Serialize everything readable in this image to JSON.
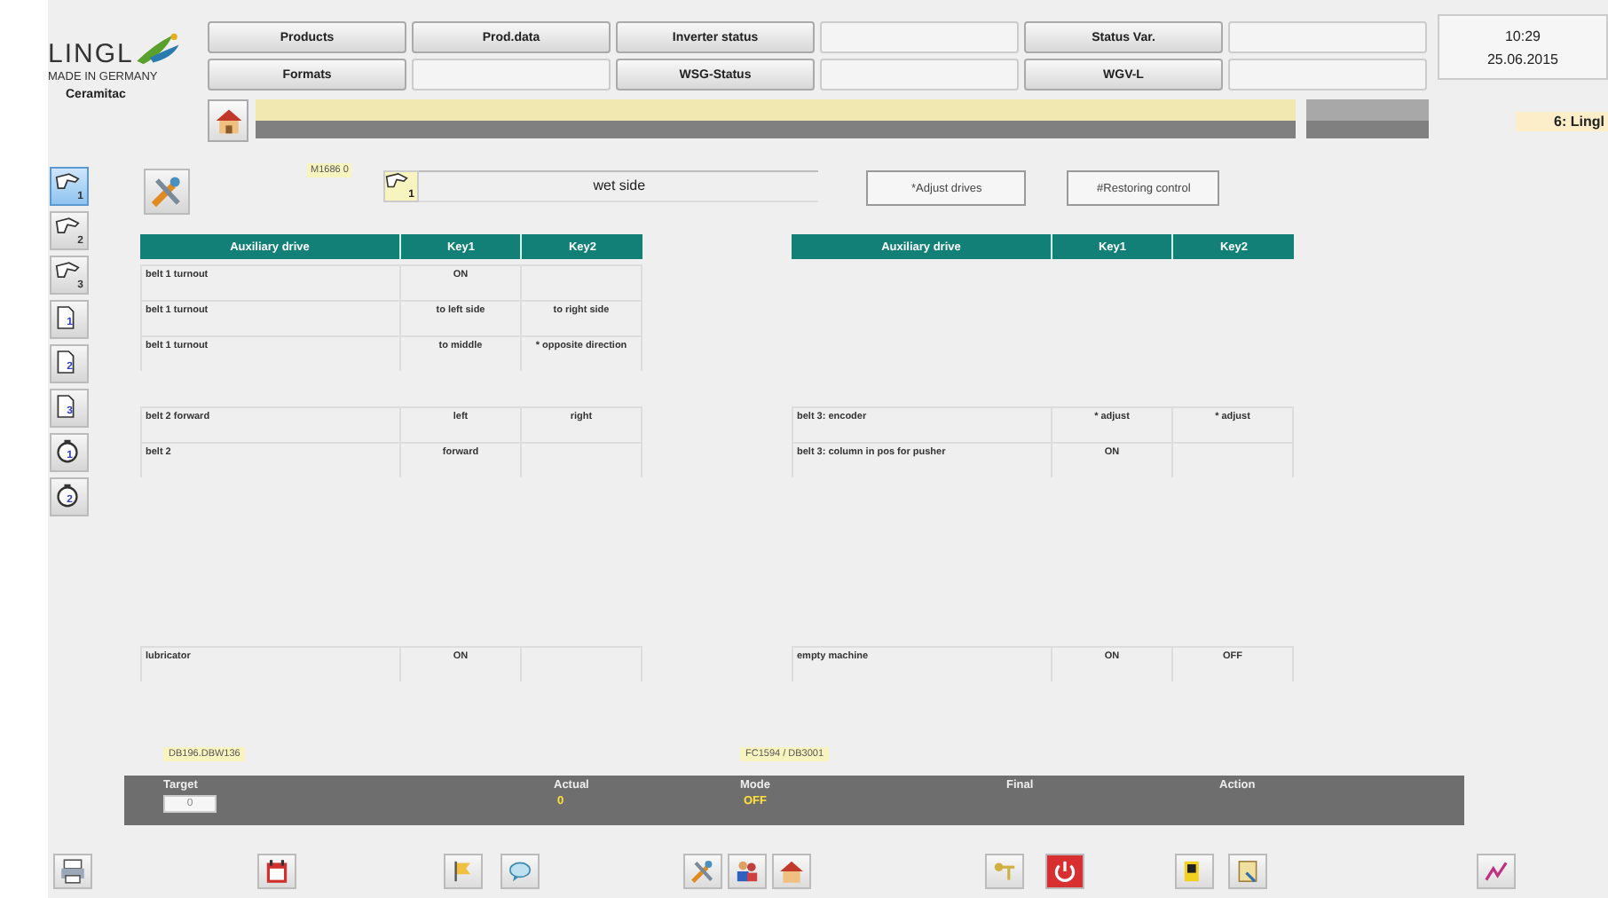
{
  "header": {
    "brand": "LINGL",
    "tagline": "MADE IN GERMANY",
    "site": "Ceramitac",
    "nav": [
      {
        "kind": "button",
        "label": "Products"
      },
      {
        "kind": "button",
        "label": "Prod.data"
      },
      {
        "kind": "button",
        "label": "Inverter status"
      },
      {
        "kind": "blank"
      },
      {
        "kind": "button",
        "label": "Status Var."
      },
      {
        "kind": "blank"
      },
      {
        "kind": "button",
        "label": "Formats"
      },
      {
        "kind": "blank"
      },
      {
        "kind": "button",
        "label": "WSG-Status"
      },
      {
        "kind": "blank"
      },
      {
        "kind": "button",
        "label": "WGV-L"
      },
      {
        "kind": "blank"
      }
    ],
    "time": "10:29",
    "date": "25.06.2015",
    "user": "6: Lingl"
  },
  "sidebar": [
    {
      "kind": "step",
      "number": "1",
      "selected": true
    },
    {
      "kind": "step",
      "number": "2",
      "selected": false
    },
    {
      "kind": "step",
      "number": "3",
      "selected": false
    },
    {
      "kind": "document",
      "number": "1",
      "selected": false
    },
    {
      "kind": "document",
      "number": "2",
      "selected": false
    },
    {
      "kind": "document",
      "number": "3",
      "selected": false
    },
    {
      "kind": "timer",
      "number": "1",
      "selected": false
    },
    {
      "kind": "timer",
      "number": "2",
      "selected": false
    }
  ],
  "panel": {
    "address": "M1686 0",
    "step": "1",
    "title": "wet side",
    "buttons": [
      "*Adjust drives",
      "#Restoring control"
    ]
  },
  "tables": [
    {
      "columns": [
        "Auxiliary drive",
        "Key1",
        "Key2"
      ],
      "row_groups": [
        {
          "kind": "rows",
          "rows": [
            {
              "drive": "belt 1 turnout",
              "key1": "ON"
            },
            {
              "drive": "belt 1 turnout",
              "key1": "to left side",
              "key2": "to right side"
            },
            {
              "drive": "belt 1 turnout",
              "key1": "to middle",
              "key2": "* opposite direction"
            }
          ]
        },
        {
          "kind": "rows",
          "rows": [
            {
              "drive": "belt 2 forward",
              "key1": "left",
              "key2": "right"
            },
            {
              "drive": "belt 2",
              "key1": "forward"
            }
          ]
        }
      ],
      "last_row": {
        "drive": "lubricator",
        "key1": "ON"
      }
    },
    {
      "columns": [
        "Auxiliary drive",
        "Key1",
        "Key2"
      ],
      "row_groups": [
        {
          "kind": "blank"
        },
        {
          "kind": "rows",
          "rows": [
            {
              "drive": "belt 3: encoder",
              "key1": "* adjust",
              "key2": "* adjust"
            },
            {
              "drive": "belt 3: column in pos for pusher",
              "key1": "ON"
            }
          ]
        }
      ],
      "last_row": {
        "drive": "empty machine",
        "key1": "ON",
        "key2": "OFF"
      }
    }
  ],
  "status": {
    "addresses": [
      "DB196.DBW136",
      "FC1594 / DB3001"
    ],
    "columns": [
      {
        "kind": "input",
        "label": "Target",
        "value": "0"
      },
      {
        "kind": "value",
        "label": "Actual",
        "value": "0"
      },
      {
        "kind": "value",
        "label": "Mode",
        "value": "OFF"
      },
      {
        "kind": "label",
        "label": "Final"
      },
      {
        "kind": "label",
        "label": "Action"
      }
    ]
  }
}
